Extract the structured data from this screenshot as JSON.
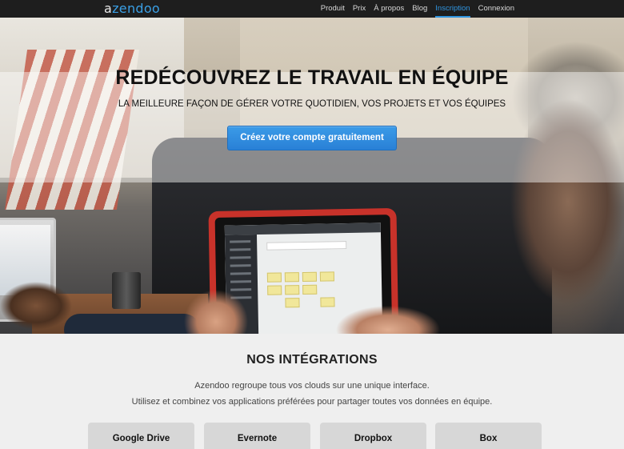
{
  "nav": {
    "logo": {
      "part1": "a",
      "part2": "zendoo"
    },
    "items": [
      {
        "label": "Produit",
        "active": false
      },
      {
        "label": "Prix",
        "active": false
      },
      {
        "label": "À propos",
        "active": false
      },
      {
        "label": "Blog",
        "active": false
      },
      {
        "label": "Inscription",
        "active": true
      },
      {
        "label": "Connexion",
        "active": false
      }
    ]
  },
  "hero": {
    "title": "REDÉCOUVREZ LE TRAVAIL EN ÉQUIPE",
    "subtitle": "LA MEILLEURE FAÇON DE GÉRER VOTRE QUOTIDIEN, VOS PROJETS ET VOS ÉQUIPES",
    "cta_label": "Créez votre compte gratuitement"
  },
  "integrations": {
    "title": "NOS INTÉGRATIONS",
    "line1": "Azendoo regroupe tous vos clouds sur une unique interface.",
    "line2": "Utilisez et combinez vos applications préférées pour partager toutes vos données en équipe.",
    "cards": [
      {
        "label": "Google Drive"
      },
      {
        "label": "Evernote"
      },
      {
        "label": "Dropbox"
      },
      {
        "label": "Box"
      }
    ]
  },
  "colors": {
    "accent": "#2f95e0",
    "topbar": "#1e1e1e",
    "cta": "#3b9be8",
    "card": "#d7d7d7"
  }
}
